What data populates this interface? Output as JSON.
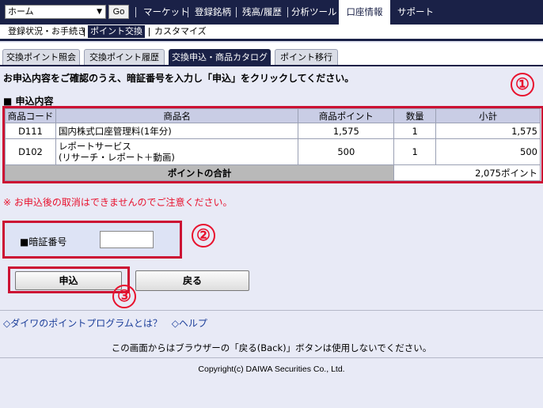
{
  "topnav": {
    "select_value": "ホーム",
    "go_label": "Go",
    "items": [
      "マーケット",
      "登録銘柄",
      "残高/履歴",
      "分析ツール"
    ],
    "active": "口座情報",
    "support": "サポート"
  },
  "subnav": {
    "items": [
      "登録状況・お手続き",
      "ポイント交換",
      "カスタマイズ"
    ]
  },
  "tabs": [
    "交換ポイント照会",
    "交換ポイント履歴",
    "交換申込・商品カタログ",
    "ポイント移行"
  ],
  "instruction": "お申込内容をご確認のうえ、暗証番号を入力し「申込」をクリックしてください。",
  "section_label": "■ 申込内容",
  "markers": [
    "①",
    "②",
    "③"
  ],
  "table": {
    "headers": [
      "商品コード",
      "商品名",
      "商品ポイント",
      "数量",
      "小計"
    ],
    "rows": [
      {
        "code": "D111",
        "name_line1": "国内株式口座管理料(1年分)",
        "name_line2": "",
        "points": "1,575",
        "qty": "1",
        "subtotal": "1,575"
      },
      {
        "code": "D102",
        "name_line1": "レポートサービス",
        "name_line2": "(リサーチ・レポート＋動画)",
        "points": "500",
        "qty": "1",
        "subtotal": "500"
      }
    ],
    "total_label": "ポイントの合計",
    "total_value": "2,075ポイント"
  },
  "warning": "※ お申込後の取消はできませんのでご注意ください。",
  "pin": {
    "label": "■暗証番号",
    "value": ""
  },
  "buttons": {
    "submit": "申込",
    "back": "戻る"
  },
  "links": [
    "◇ダイワのポイントプログラムとは？",
    "◇ヘルプ"
  ],
  "footnote": "この画面からはブラウザーの「戻る(Back)」ボタンは使用しないでください。",
  "copyright": "Copyright(c) DAIWA Securities Co., Ltd.",
  "colors": {
    "nav": "#1a2147",
    "highlight": "#cc1133",
    "marker": "#e8112d"
  }
}
